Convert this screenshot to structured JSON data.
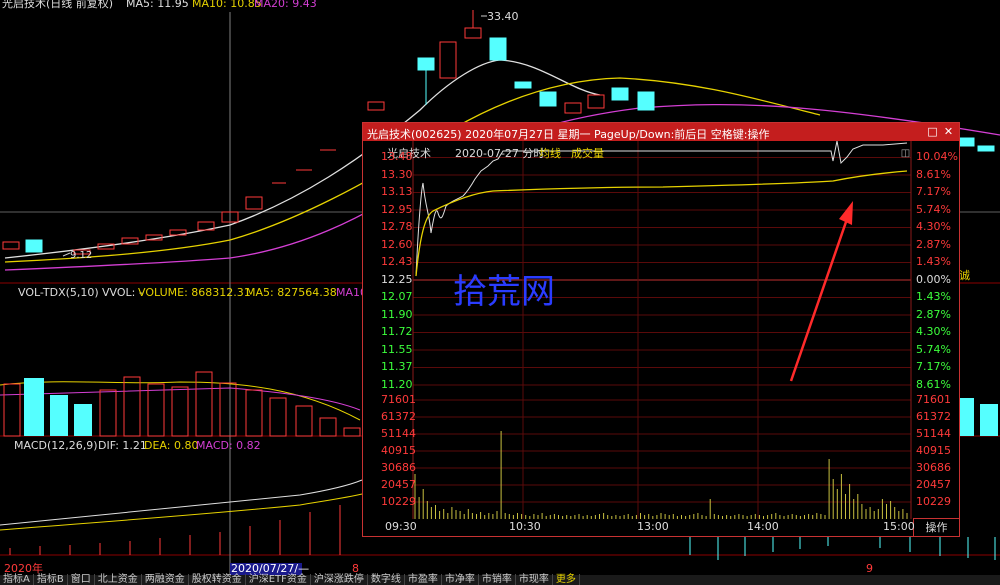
{
  "main": {
    "title": "光启技术(日线 前复权)",
    "ma_labels": [
      {
        "text": "MA5: 11.95",
        "color": "#e0e0e0"
      },
      {
        "text": "MA10: 10.85",
        "color": "#e6d200"
      },
      {
        "text": "MA20: 9.43",
        "color": "#d43fd4"
      }
    ],
    "high_label": "33.40",
    "low_label": "9.12",
    "date_labels": {
      "year": "2020年",
      "cursor": "2020/07/27/—",
      "m8": "8",
      "m9": "9"
    },
    "side_label": "诚"
  },
  "vol": {
    "label": "VOL-TDX(5,10)",
    "vvol": "VVOL: -",
    "volume": "VOLUME: 868312.31",
    "ma5": "MA5: 827564.38",
    "ma10": "MA10"
  },
  "macd": {
    "label": "MACD(12,26,9)",
    "dif": "DIF: 1.21",
    "dea": "DEA: 0.80",
    "macd": "MACD: 0.82"
  },
  "popup": {
    "title": "光启技术(002625) 2020年07月27日 星期一 PageUp/Down:前后日 空格键:操作",
    "name": "光启技术",
    "date": "2020-07-27 分时",
    "avg_line": "均线",
    "deal_vol": "成交量",
    "watermark": "拾荒网",
    "op_button": "操作",
    "price_ticks": [
      "13.48",
      "13.30",
      "13.13",
      "12.95",
      "12.78",
      "12.60",
      "12.43",
      "12.25",
      "12.07",
      "11.90",
      "11.72",
      "11.55",
      "11.37",
      "11.20"
    ],
    "pct_ticks": [
      "10.04%",
      "8.61%",
      "7.17%",
      "5.74%",
      "4.30%",
      "2.87%",
      "1.43%",
      "0.00%",
      "1.43%",
      "2.87%",
      "4.30%",
      "5.74%",
      "7.17%",
      "8.61%"
    ],
    "vol_ticks": [
      "71601",
      "61372",
      "51144",
      "40915",
      "30686",
      "20457",
      "10229"
    ],
    "time_ticks": [
      "09:30",
      "10:30",
      "13:00",
      "14:00",
      "15:00"
    ]
  },
  "bottom_tabs": [
    "指标A",
    "指标B",
    "窗口",
    "北上资金",
    "两融资金",
    "股权转资金",
    "沪深ETF资金",
    "沪深涨跌停",
    "数字线",
    "市盈率",
    "市净率",
    "市销率",
    "市现率",
    "更多"
  ]
}
